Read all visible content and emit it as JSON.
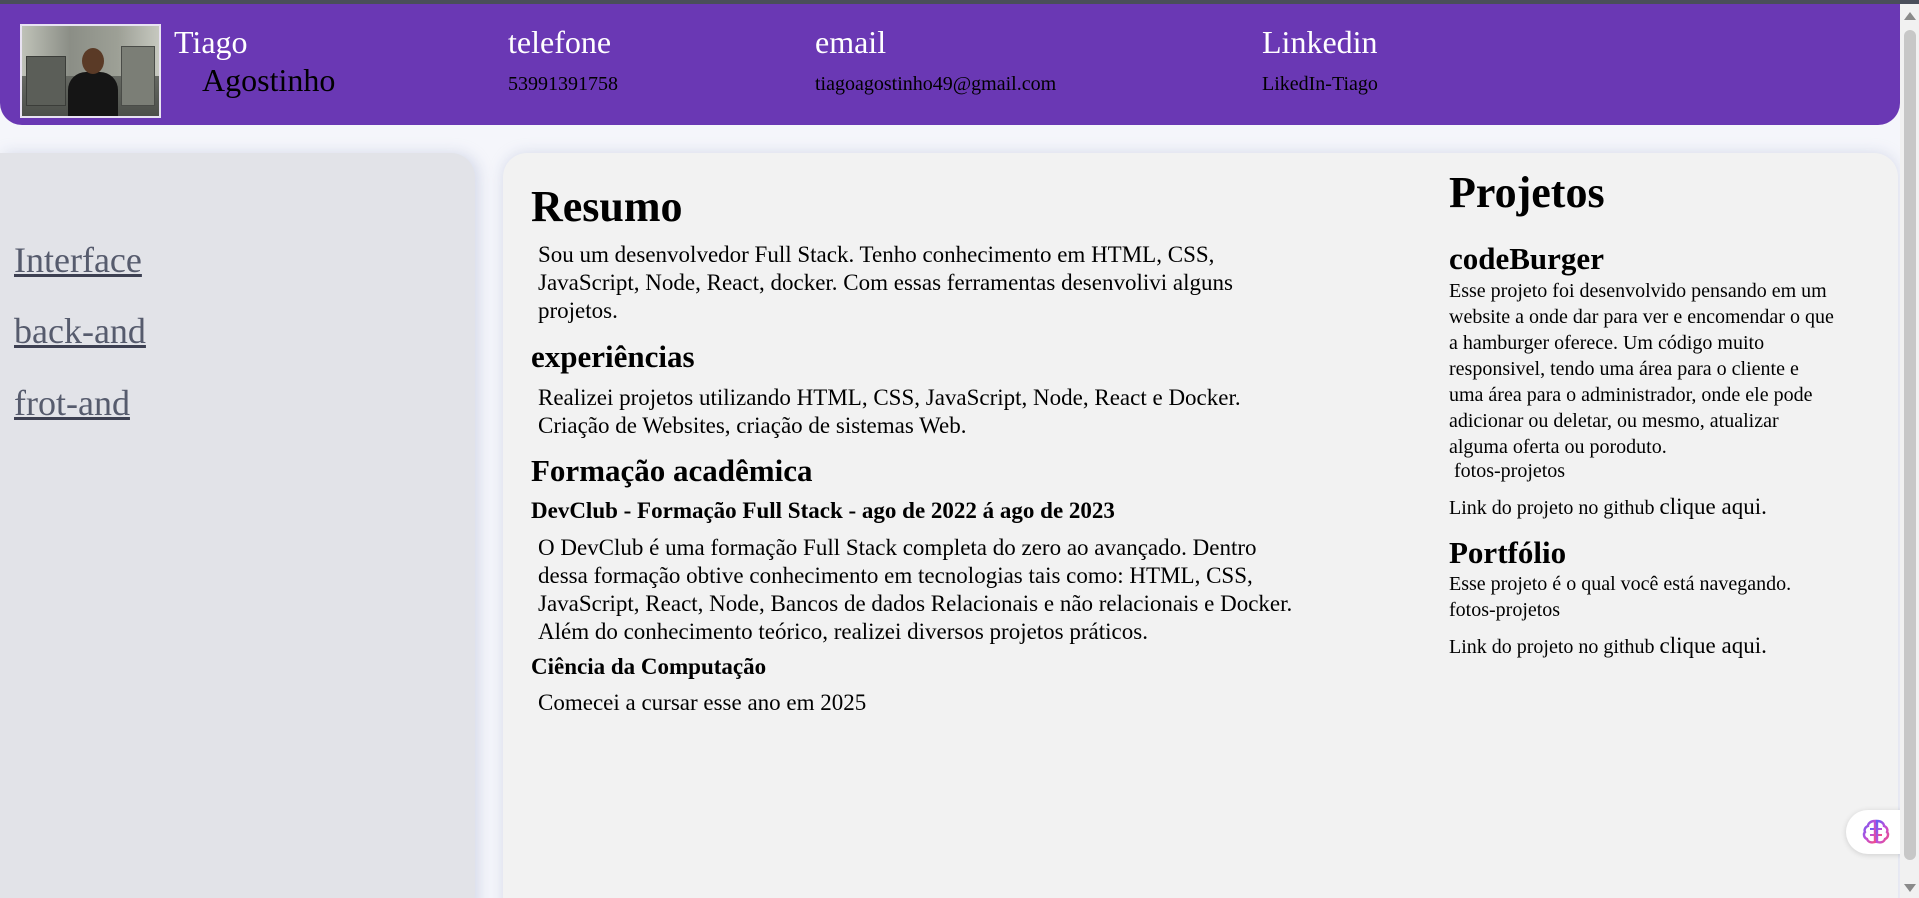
{
  "header": {
    "first_name": "Tiago",
    "last_name": "Agostinho",
    "phone_label": "telefone",
    "phone_value": "53991391758",
    "email_label": "email",
    "email_value": "tiagoagostinho49@gmail.com",
    "linkedin_label": "Linkedin",
    "linkedin_value": "LikedIn-Tiago"
  },
  "sidebar": {
    "items": [
      {
        "label": "Interface"
      },
      {
        "label": "back-and"
      },
      {
        "label": "frot-and"
      }
    ]
  },
  "main": {
    "resumo_title": "Resumo",
    "resumo_lines": [
      "Sou um desenvolvedor Full Stack. Tenho conhecimento em HTML, CSS,",
      "JavaScript, Node, React, docker. Com essas ferramentas desenvolivi alguns",
      "projetos."
    ],
    "exp_title": "experiências",
    "exp_lines": [
      "Realizei projetos utilizando HTML, CSS, JavaScript, Node, React e Docker.",
      "Criação de Websites, criação de sistemas Web."
    ],
    "formacao_title": "Formação acadêmica",
    "devclub_title": "DevClub - Formação Full Stack - ago de 2022 á ago de 2023",
    "devclub_lines": [
      "O DevClub é uma formação Full Stack completa do zero ao avançado. Dentro",
      "dessa formação obtive conhecimento em tecnologias tais como: HTML, CSS,",
      "JavaScript, React, Node, Bancos de dados Relacionais e não relacionais e Docker.",
      "Além do conhecimento teórico, realizei diversos projetos práticos."
    ],
    "cc_title": "Ciência da Computação",
    "cc_text": "Comecei a cursar esse ano em 2025"
  },
  "projetos": {
    "title": "Projetos",
    "codeburger_title": "codeBurger",
    "codeburger_lines": [
      "Esse projeto foi desenvolvido pensando em um",
      "website a onde dar para ver e encomendar o que",
      "a hamburger oferece. Um código muito",
      "responsivel, tendo uma área para o cliente e",
      "uma área para o administrador, onde ele pode",
      "adicionar ou deletar, ou mesmo, atualizar",
      "alguma oferta ou poroduto."
    ],
    "image_alt": "fotos-projetos",
    "github_text": "Link do projeto no github",
    "github_link": "clique aqui.",
    "portfolio_title": "Portfólio",
    "portfolio_text": "Esse projeto é o qual você está navegando.",
    "colors": {
      "header": "#6a38b4",
      "sidebar": "#e2e3e8",
      "main": "#f2f2f2"
    }
  }
}
